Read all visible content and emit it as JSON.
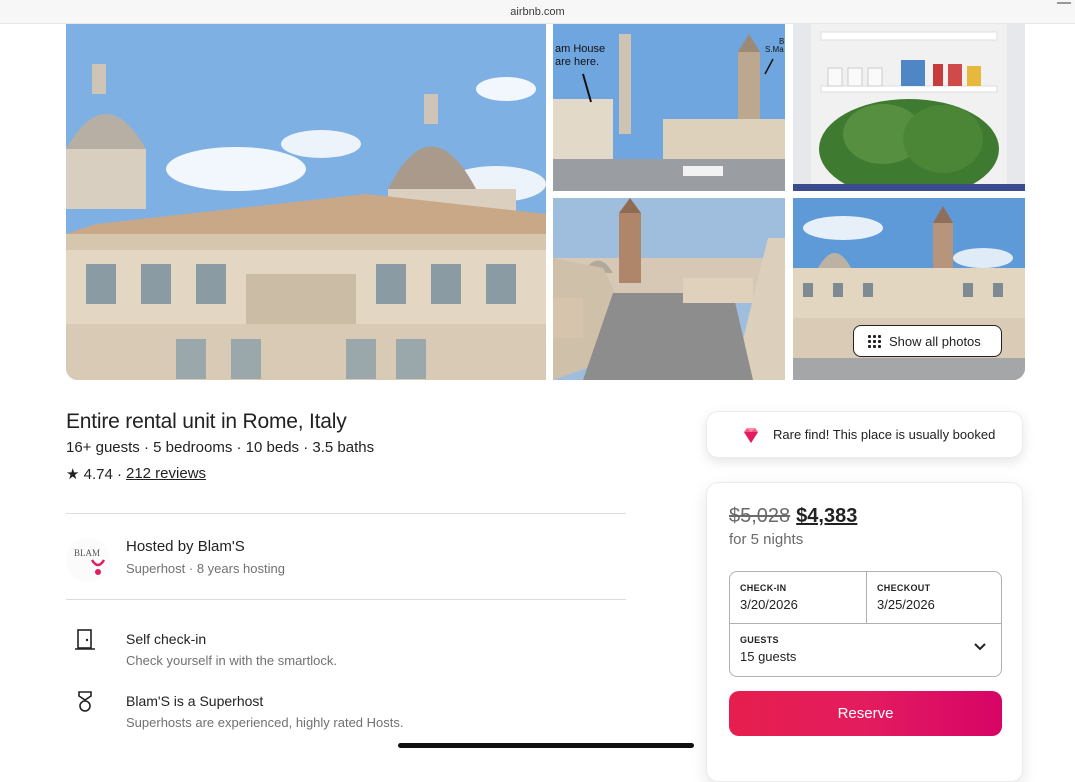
{
  "browser": {
    "url": "airbnb.com"
  },
  "gallery": {
    "photo2_caption_a": "am House",
    "photo2_caption_b": "are here.",
    "photo2_caption_c": "B",
    "photo2_caption_d": "S.Ma",
    "show_all_label": "Show all photos"
  },
  "listing": {
    "title": "Entire rental unit in Rome, Italy",
    "summary": "16+ guests · 5 bedrooms · 10 beds · 3.5 baths",
    "rating": "★ 4.74 ·",
    "reviews_link": "212 reviews"
  },
  "host": {
    "logo_text": "BLAM",
    "name": "Hosted by Blam'S",
    "meta": "Superhost · 8 years hosting"
  },
  "features": [
    {
      "icon": "door-icon",
      "title": "Self check-in",
      "desc": "Check yourself in with the smartlock."
    },
    {
      "icon": "superhost-medal-icon",
      "title": "Blam'S is a Superhost",
      "desc": "Superhosts are experienced, highly rated Hosts."
    }
  ],
  "rare_find": {
    "icon": "diamond-icon",
    "text": "Rare find! This place is usually booked"
  },
  "booking": {
    "old_price": "$5,028",
    "new_price": "$4,383",
    "nights": "for 5 nights",
    "checkin_label": "CHECK-IN",
    "checkin_value": "3/20/2026",
    "checkout_label": "CHECKOUT",
    "checkout_value": "3/25/2026",
    "guests_label": "GUESTS",
    "guests_value": "15 guests",
    "reserve_label": "Reserve"
  },
  "colors": {
    "brand": "#e31c5f",
    "text": "#222222",
    "muted": "#717171"
  }
}
